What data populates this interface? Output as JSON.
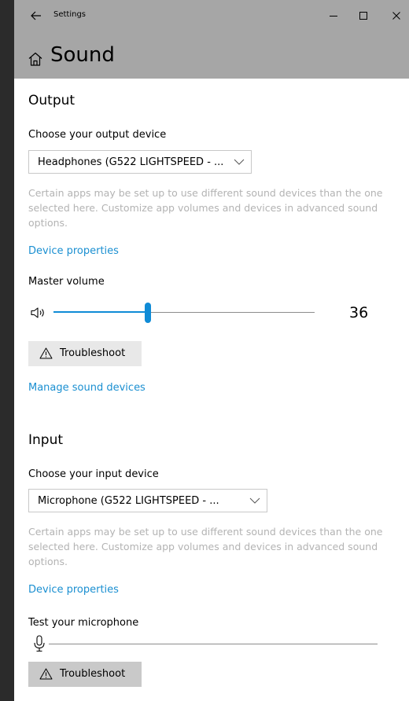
{
  "window": {
    "title": "Settings",
    "controls": {
      "minimize": "minimize-icon",
      "maximize": "maximize-icon",
      "close": "close-icon"
    }
  },
  "page": {
    "title": "Sound",
    "icon": "home-icon"
  },
  "output": {
    "section_title": "Output",
    "device_label": "Choose your output device",
    "device_value": "Headphones (G522 LIGHTSPEED - ...",
    "help_text": "Certain apps may be set up to use different sound devices than the one selected here. Customize app volumes and devices in advanced sound options.",
    "device_properties": "Device properties",
    "volume_label": "Master volume",
    "volume_value": "36",
    "volume_level": 0.36,
    "troubleshoot": "Troubleshoot",
    "manage_devices": "Manage sound devices"
  },
  "input": {
    "section_title": "Input",
    "device_label": "Choose your input device",
    "device_value": "Microphone (G522 LIGHTSPEED - ...",
    "help_text": "Certain apps may be set up to use different sound devices than the one selected here. Customize app volumes and devices in advanced sound options.",
    "device_properties": "Device properties",
    "test_label": "Test your microphone",
    "troubleshoot": "Troubleshoot"
  },
  "colors": {
    "accent": "#0f8bd6",
    "header_bg": "#a6a6a6",
    "link": "#1a8fd1",
    "help_text": "#b3b3b3"
  }
}
